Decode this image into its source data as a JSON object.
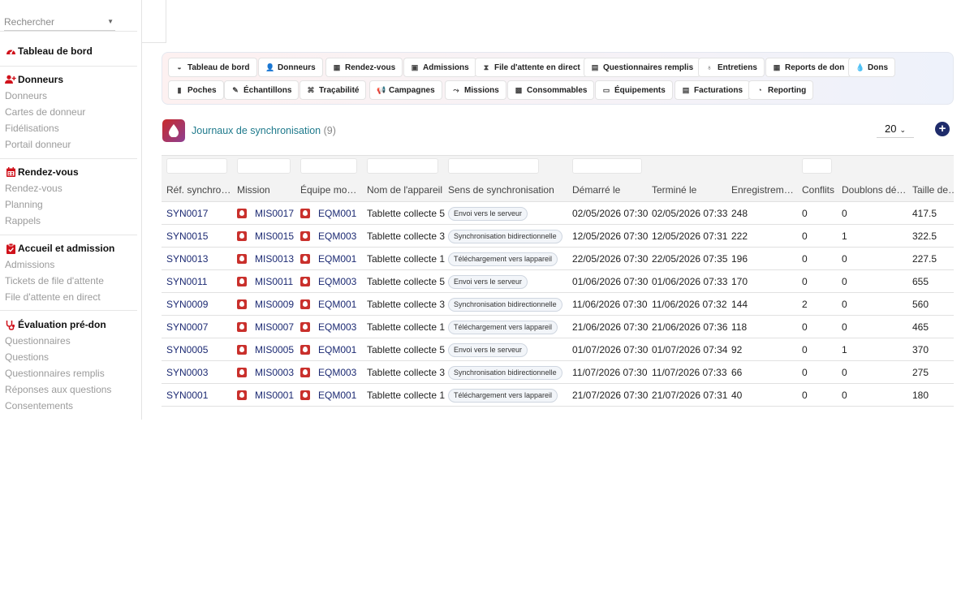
{
  "search": {
    "placeholder": "Rechercher"
  },
  "sidebar": {
    "dashboard": "Tableau de bord",
    "sections": [
      {
        "title": "Donneurs",
        "icon": "user-plus-icon",
        "items": [
          "Donneurs",
          "Cartes de donneur",
          "Fidélisations",
          "Portail donneur"
        ]
      },
      {
        "title": "Rendez-vous",
        "icon": "calendar-icon",
        "items": [
          "Rendez-vous",
          "Planning",
          "Rappels"
        ]
      },
      {
        "title": "Accueil et admission",
        "icon": "clipboard-icon",
        "items": [
          "Admissions",
          "Tickets de file d'attente",
          "File d'attente en direct"
        ]
      },
      {
        "title": "Évaluation pré-don",
        "icon": "stethoscope-icon",
        "items": [
          "Questionnaires",
          "Questions",
          "Questionnaires remplis",
          "Réponses aux questions",
          "Consentements"
        ]
      }
    ]
  },
  "toolbar": {
    "row1": [
      "Tableau de bord",
      "Donneurs",
      "Rendez-vous",
      "Admissions",
      "File d'attente en direct",
      "Questionnaires remplis",
      "Entretiens",
      "Reports de don",
      "Dons"
    ],
    "row2": [
      "Poches",
      "Échantillons",
      "Traçabilité",
      "Campagnes",
      "Missions",
      "Consommables",
      "Équipements",
      "Facturations",
      "Reporting"
    ]
  },
  "page": {
    "title": "Journaux de synchronisation",
    "count": "(9)",
    "page_size": "20",
    "add_label": "+"
  },
  "table": {
    "columns": [
      "Réf. synchro…",
      "Mission",
      "Équipe mobile",
      "Nom de l'appareil",
      "Sens de synchronisation",
      "Démarré le",
      "Terminé le",
      "Enregistrem…",
      "Conflits",
      "Doublons dé…",
      "Taille des d"
    ],
    "rows": [
      [
        "SYN0017",
        "MIS0017",
        "EQM001",
        "Tablette collecte 5",
        "Envoi vers le serveur",
        "02/05/2026 07:30",
        "02/05/2026 07:33",
        "248",
        "0",
        "0",
        "417.5"
      ],
      [
        "SYN0015",
        "MIS0015",
        "EQM003",
        "Tablette collecte 3",
        "Synchronisation bidirectionnelle",
        "12/05/2026 07:30",
        "12/05/2026 07:31",
        "222",
        "0",
        "1",
        "322.5"
      ],
      [
        "SYN0013",
        "MIS0013",
        "EQM001",
        "Tablette collecte 1",
        "Téléchargement vers lappareil",
        "22/05/2026 07:30",
        "22/05/2026 07:35",
        "196",
        "0",
        "0",
        "227.5"
      ],
      [
        "SYN0011",
        "MIS0011",
        "EQM003",
        "Tablette collecte 5",
        "Envoi vers le serveur",
        "01/06/2026 07:30",
        "01/06/2026 07:33",
        "170",
        "0",
        "0",
        "655"
      ],
      [
        "SYN0009",
        "MIS0009",
        "EQM001",
        "Tablette collecte 3",
        "Synchronisation bidirectionnelle",
        "11/06/2026 07:30",
        "11/06/2026 07:32",
        "144",
        "2",
        "0",
        "560"
      ],
      [
        "SYN0007",
        "MIS0007",
        "EQM003",
        "Tablette collecte 1",
        "Téléchargement vers lappareil",
        "21/06/2026 07:30",
        "21/06/2026 07:36",
        "118",
        "0",
        "0",
        "465"
      ],
      [
        "SYN0005",
        "MIS0005",
        "EQM001",
        "Tablette collecte 5",
        "Envoi vers le serveur",
        "01/07/2026 07:30",
        "01/07/2026 07:34",
        "92",
        "0",
        "1",
        "370"
      ],
      [
        "SYN0003",
        "MIS0003",
        "EQM003",
        "Tablette collecte 3",
        "Synchronisation bidirectionnelle",
        "11/07/2026 07:30",
        "11/07/2026 07:33",
        "66",
        "0",
        "0",
        "275"
      ],
      [
        "SYN0001",
        "MIS0001",
        "EQM001",
        "Tablette collecte 1",
        "Téléchargement vers lappareil",
        "21/07/2026 07:30",
        "21/07/2026 07:31",
        "40",
        "0",
        "0",
        "180"
      ]
    ]
  }
}
